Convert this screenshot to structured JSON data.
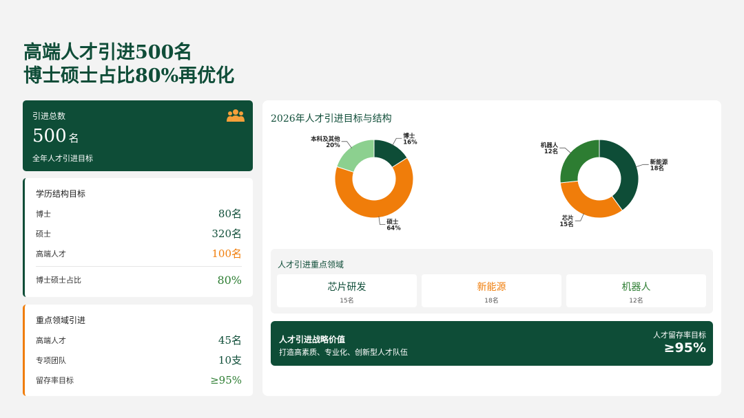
{
  "headline": {
    "line1": "高端人才引进500名",
    "line2": "博士硕士占比80%再优化"
  },
  "total_card": {
    "label": "引进总数",
    "value": "500",
    "unit": "名",
    "sub": "全年人才引进目标",
    "icon": "people-icon"
  },
  "education": {
    "title": "学历结构目标",
    "rows": [
      {
        "k": "博士",
        "v": "80名"
      },
      {
        "k": "硕士",
        "v": "320名"
      },
      {
        "k": "高端人才",
        "v": "100名"
      }
    ],
    "ratio_label": "博士硕士占比",
    "ratio_value": "80%"
  },
  "focus_left": {
    "title": "重点领域引进",
    "rows": [
      {
        "k": "高端人才",
        "v": "45名"
      },
      {
        "k": "专项团队",
        "v": "10支"
      },
      {
        "k": "留存率目标",
        "v": "≥95%"
      }
    ]
  },
  "main": {
    "title": "2026年人才引进目标与结构"
  },
  "chart_data": [
    {
      "type": "pie",
      "categories": [
        "博士",
        "硕士",
        "本科及其他"
      ],
      "values": [
        16,
        64,
        20
      ],
      "labels": [
        "16%",
        "64%",
        "20%"
      ],
      "colors": [
        "#0e4d37",
        "#f07d0a",
        "#8cd08f"
      ]
    },
    {
      "type": "pie",
      "categories": [
        "新能源",
        "芯片",
        "机器人"
      ],
      "values": [
        18,
        15,
        12
      ],
      "labels": [
        "18名",
        "15名",
        "12名"
      ],
      "colors": [
        "#0e4d37",
        "#f07d0a",
        "#2d7d32"
      ]
    }
  ],
  "focus_section": {
    "title": "人才引进重点领域",
    "cards": [
      {
        "name": "芯片研发",
        "count": "15名"
      },
      {
        "name": "新能源",
        "count": "18名"
      },
      {
        "name": "机器人",
        "count": "12名"
      }
    ]
  },
  "value_bar": {
    "title": "人才引进战略价值",
    "sub": "打造高素质、专业化、创新型人才队伍",
    "retention_label": "人才留存率目标",
    "retention_value": "≥95%"
  }
}
